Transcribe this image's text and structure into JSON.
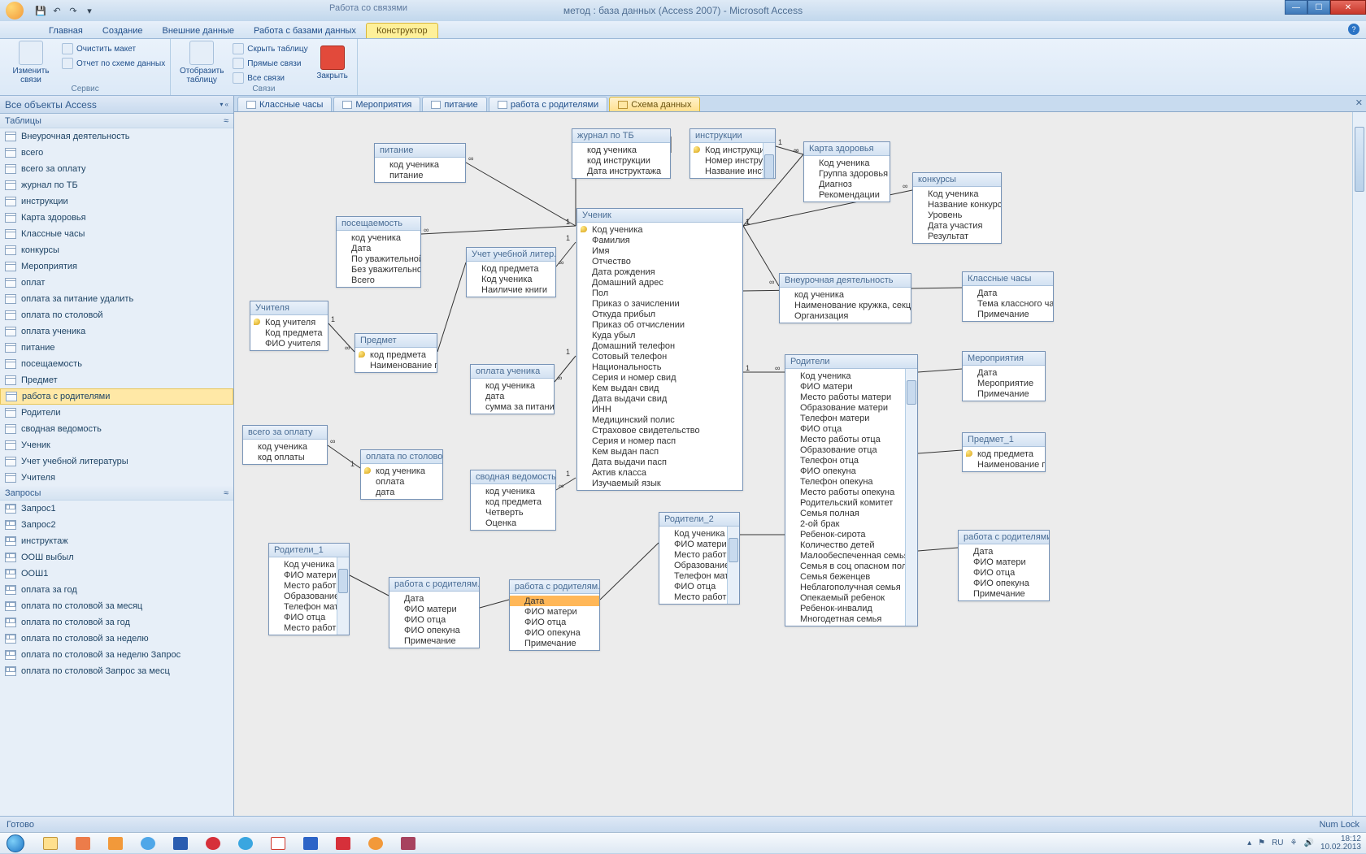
{
  "title": "метод : база данных (Access 2007) - Microsoft Access",
  "context_tab_group": "Работа со связями",
  "menu": {
    "home": "Главная",
    "create": "Создание",
    "external": "Внешние данные",
    "dbtools": "Работа с базами данных",
    "design": "Конструктор"
  },
  "ribbon": {
    "group1_label": "Сервис",
    "edit_rel_top": "Изменить",
    "edit_rel_bot": "связи",
    "clear_layout": "Очистить макет",
    "rel_report": "Отчет по схеме данных",
    "group2_label": "Связи",
    "show_table_top": "Отобразить",
    "show_table_bot": "таблицу",
    "hide_table": "Скрыть таблицу",
    "direct_rel": "Прямые связи",
    "all_rel": "Все связи",
    "close": "Закрыть"
  },
  "nav": {
    "header": "Все объекты Access",
    "group_tables": "Таблицы",
    "group_queries": "Запросы",
    "tables": [
      "Внеурочная деятельность",
      "всего",
      "всего за оплату",
      "журнал по ТБ",
      "инструкции",
      "Карта здоровья",
      "Классные часы",
      "конкурсы",
      "Мероприятия",
      "оплат",
      "оплата за питание удалить",
      "оплата по столовой",
      "оплата ученика",
      "питание",
      "посещаемость",
      "Предмет",
      "работа с родителями",
      "Родители",
      "сводная ведомость",
      "Ученик",
      "Учет учебной литературы",
      "Учителя"
    ],
    "selected_table_index": 16,
    "queries": [
      "Запрос1",
      "Запрос2",
      "инструктаж",
      "ООШ выбыл",
      "ООШ1",
      "оплата за год",
      "оплата по столовой  за месяц",
      "оплата по столовой за год",
      "оплата по столовой за неделю",
      "оплата по столовой за неделю Запрос",
      "оплата по столовой Запрос за месц"
    ]
  },
  "doc_tabs": [
    {
      "label": "Классные часы"
    },
    {
      "label": "Мероприятия"
    },
    {
      "label": "питание"
    },
    {
      "label": "работа с родителями"
    },
    {
      "label": "Схема данных",
      "active": true
    }
  ],
  "tables": {
    "pit": {
      "title": "питание",
      "fields": [
        {
          "n": "код ученика"
        },
        {
          "n": "питание"
        }
      ]
    },
    "pos": {
      "title": "посещаемость",
      "fields": [
        {
          "n": "код ученика"
        },
        {
          "n": "Дата"
        },
        {
          "n": "По уважительной"
        },
        {
          "n": "Без уважительной"
        },
        {
          "n": "Всего"
        }
      ]
    },
    "uch": {
      "title": "Учителя",
      "fields": [
        {
          "n": "Код учителя",
          "pk": true
        },
        {
          "n": "Код предмета"
        },
        {
          "n": "ФИО учителя"
        }
      ]
    },
    "pred": {
      "title": "Предмет",
      "fields": [
        {
          "n": "код предмета",
          "pk": true
        },
        {
          "n": "Наименование пр"
        }
      ]
    },
    "vso": {
      "title": "всего за оплату",
      "fields": [
        {
          "n": "код ученика"
        },
        {
          "n": "код оплаты"
        }
      ]
    },
    "opst": {
      "title": "оплата по столовой",
      "fields": [
        {
          "n": "код ученика",
          "pk": true
        },
        {
          "n": "оплата"
        },
        {
          "n": "дата"
        }
      ]
    },
    "rod1": {
      "title": "Родители_1",
      "fields": [
        {
          "n": "Код ученика"
        },
        {
          "n": "ФИО матери"
        },
        {
          "n": "Место работы"
        },
        {
          "n": "Образование м"
        },
        {
          "n": "Телефон матер"
        },
        {
          "n": "ФИО отца"
        },
        {
          "n": "Место работы"
        }
      ]
    },
    "rsr1": {
      "title": "работа с родителям...",
      "fields": [
        {
          "n": "Дата"
        },
        {
          "n": "ФИО матери"
        },
        {
          "n": "ФИО отца"
        },
        {
          "n": "ФИО опекуна"
        },
        {
          "n": "Примечание"
        }
      ]
    },
    "uul": {
      "title": "Учет учебной литер...",
      "fields": [
        {
          "n": "Код предмета"
        },
        {
          "n": "Код ученика"
        },
        {
          "n": "Наиличие книги"
        }
      ]
    },
    "opu": {
      "title": "оплата ученика",
      "fields": [
        {
          "n": "код ученика"
        },
        {
          "n": "дата"
        },
        {
          "n": "сумма за питание"
        }
      ]
    },
    "sv": {
      "title": "сводная ведомость",
      "fields": [
        {
          "n": "код ученика"
        },
        {
          "n": "код предмета"
        },
        {
          "n": "Четверть"
        },
        {
          "n": "Оценка"
        }
      ]
    },
    "rsr2": {
      "title": "работа с родителям...",
      "fields": [
        {
          "n": "Дата",
          "sel": true
        },
        {
          "n": "ФИО матери"
        },
        {
          "n": "ФИО отца"
        },
        {
          "n": "ФИО опекуна"
        },
        {
          "n": "Примечание"
        }
      ]
    },
    "jtb": {
      "title": "журнал по ТБ",
      "fields": [
        {
          "n": "код ученика"
        },
        {
          "n": "код инструкции"
        },
        {
          "n": "Дата инструктажа"
        }
      ]
    },
    "instr": {
      "title": "инструкции",
      "fields": [
        {
          "n": "Код инструкции",
          "pk": true
        },
        {
          "n": "Номер инструкци"
        },
        {
          "n": "Название инструк"
        }
      ]
    },
    "rod2": {
      "title": "Родители_2",
      "fields": [
        {
          "n": "Код ученика"
        },
        {
          "n": "ФИО матери"
        },
        {
          "n": "Место работы"
        },
        {
          "n": "Образование м"
        },
        {
          "n": "Телефон матер"
        },
        {
          "n": "ФИО отца"
        },
        {
          "n": "Место работы"
        }
      ]
    },
    "uchk": {
      "title": "Ученик",
      "fields": [
        {
          "n": "Код ученика",
          "pk": true
        },
        {
          "n": "Фамилия"
        },
        {
          "n": "Имя"
        },
        {
          "n": "Отчество"
        },
        {
          "n": "Дата рождения"
        },
        {
          "n": "Домашний адрес"
        },
        {
          "n": "Пол"
        },
        {
          "n": "Приказ о зачислении"
        },
        {
          "n": "Откуда прибыл"
        },
        {
          "n": "Приказ об отчислении"
        },
        {
          "n": "Куда убыл"
        },
        {
          "n": "Домашний телефон"
        },
        {
          "n": "Сотовый телефон"
        },
        {
          "n": "Национальность"
        },
        {
          "n": "Серия и номер свид"
        },
        {
          "n": "Кем выдан свид"
        },
        {
          "n": "Дата выдачи свид"
        },
        {
          "n": "ИНН"
        },
        {
          "n": "Медицинский полис"
        },
        {
          "n": "Страховое свидетельство"
        },
        {
          "n": "Серия и номер пасп"
        },
        {
          "n": "Кем выдан пасп"
        },
        {
          "n": "Дата выдачи пасп"
        },
        {
          "n": "Актив класса"
        },
        {
          "n": "Изучаемый язык"
        }
      ]
    },
    "kz": {
      "title": "Карта здоровья",
      "fields": [
        {
          "n": "Код ученика"
        },
        {
          "n": "Группа здоровья"
        },
        {
          "n": "Диагноз"
        },
        {
          "n": "Рекомендации"
        }
      ]
    },
    "vnd": {
      "title": "Внеурочная деятельность",
      "fields": [
        {
          "n": "код ученика"
        },
        {
          "n": "Наименование кружка, секции"
        },
        {
          "n": "Организация"
        }
      ]
    },
    "rod": {
      "title": "Родители",
      "fields": [
        {
          "n": "Код ученика"
        },
        {
          "n": "ФИО матери"
        },
        {
          "n": "Место работы матери"
        },
        {
          "n": "Образование матери"
        },
        {
          "n": "Телефон матери"
        },
        {
          "n": "ФИО отца"
        },
        {
          "n": "Место работы отца"
        },
        {
          "n": "Образование отца"
        },
        {
          "n": "Телефон отца"
        },
        {
          "n": "ФИО опекуна"
        },
        {
          "n": "Телефон опекуна"
        },
        {
          "n": "Место работы опекуна"
        },
        {
          "n": "Родительский комитет"
        },
        {
          "n": "Семья полная"
        },
        {
          "n": "2-ой брак"
        },
        {
          "n": "Ребенок-сирота"
        },
        {
          "n": "Количество детей"
        },
        {
          "n": "Малообеспеченная семья"
        },
        {
          "n": "Семья в соц опасном полож"
        },
        {
          "n": "Семья беженцев"
        },
        {
          "n": "Неблагополучная семья"
        },
        {
          "n": "Опекаемый ребенок"
        },
        {
          "n": "Ребенок-инвалид"
        },
        {
          "n": "Многодетная семья"
        }
      ]
    },
    "konk": {
      "title": "конкурсы",
      "fields": [
        {
          "n": "Код ученика"
        },
        {
          "n": "Название конкурс"
        },
        {
          "n": "Уровень"
        },
        {
          "n": "Дата участия"
        },
        {
          "n": "Результат"
        }
      ]
    },
    "kch": {
      "title": "Классные часы",
      "fields": [
        {
          "n": "Дата"
        },
        {
          "n": "Тема классного ча"
        },
        {
          "n": "Примечание"
        }
      ]
    },
    "mer": {
      "title": "Мероприятия",
      "fields": [
        {
          "n": "Дата"
        },
        {
          "n": "Мероприятие"
        },
        {
          "n": "Примечание"
        }
      ]
    },
    "pred1": {
      "title": "Предмет_1",
      "fields": [
        {
          "n": "код предмета",
          "pk": true
        },
        {
          "n": "Наименование пр"
        }
      ]
    },
    "rsr3": {
      "title": "работа с родителями",
      "fields": [
        {
          "n": "Дата"
        },
        {
          "n": "ФИО матери"
        },
        {
          "n": "ФИО отца"
        },
        {
          "n": "ФИО опекуна"
        },
        {
          "n": "Примечание"
        }
      ]
    }
  },
  "status": {
    "ready": "Готово",
    "numlock": "Num Lock"
  },
  "tray": {
    "lang": "RU",
    "time": "18:12",
    "date": "10.02.2013"
  }
}
